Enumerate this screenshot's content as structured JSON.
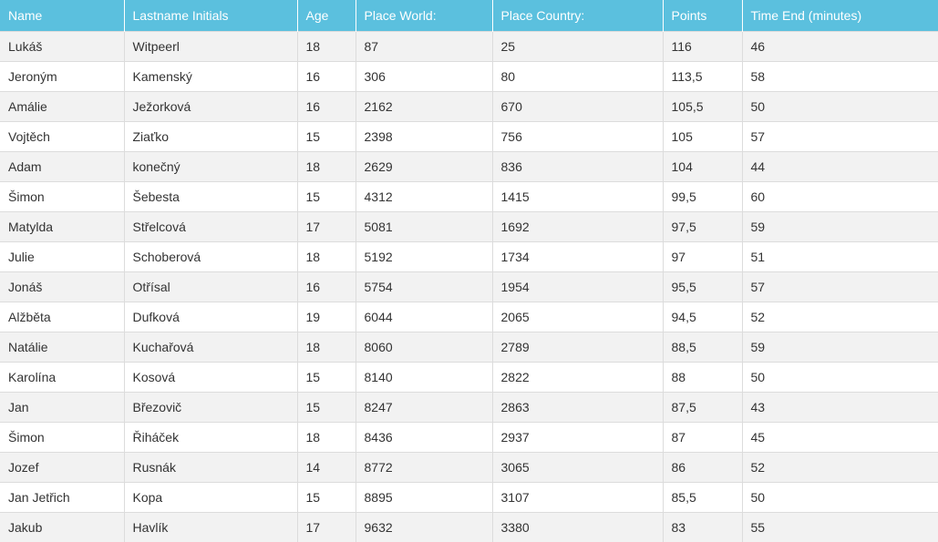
{
  "table": {
    "columns": [
      "Name",
      "Lastname Initials",
      "Age",
      "Place World:",
      "Place Country:",
      "Points",
      "Time End (minutes)"
    ],
    "rows": [
      [
        "Lukáš",
        "Witpeerl",
        "18",
        "87",
        "25",
        "116",
        "46"
      ],
      [
        "Jeroným",
        "Kamenský",
        "16",
        "306",
        "80",
        "113,5",
        "58"
      ],
      [
        "Amálie",
        "Ježorková",
        "16",
        "2162",
        "670",
        "105,5",
        "50"
      ],
      [
        "Vojtěch",
        "Ziaťko",
        "15",
        "2398",
        "756",
        "105",
        "57"
      ],
      [
        "Adam",
        "konečný",
        "18",
        "2629",
        "836",
        "104",
        "44"
      ],
      [
        "Šimon",
        "Šebesta",
        "15",
        "4312",
        "1415",
        "99,5",
        "60"
      ],
      [
        "Matylda",
        "Střelcová",
        "17",
        "5081",
        "1692",
        "97,5",
        "59"
      ],
      [
        "Julie",
        "Schoberová",
        "18",
        "5192",
        "1734",
        "97",
        "51"
      ],
      [
        "Jonáš",
        "Otřísal",
        "16",
        "5754",
        "1954",
        "95,5",
        "57"
      ],
      [
        "Alžběta",
        "Dufková",
        "19",
        "6044",
        "2065",
        "94,5",
        "52"
      ],
      [
        "Natálie",
        "Kuchařová",
        "18",
        "8060",
        "2789",
        "88,5",
        "59"
      ],
      [
        "Karolína",
        "Kosová",
        "15",
        "8140",
        "2822",
        "88",
        "50"
      ],
      [
        "Jan",
        "Březovič",
        "15",
        "8247",
        "2863",
        "87,5",
        "43"
      ],
      [
        "Šimon",
        "Řiháček",
        "18",
        "8436",
        "2937",
        "87",
        "45"
      ],
      [
        "Jozef",
        "Rusnák",
        "14",
        "8772",
        "3065",
        "86",
        "52"
      ],
      [
        "Jan Jetřich",
        "Kopa",
        "15",
        "8895",
        "3107",
        "85,5",
        "50"
      ],
      [
        "Jakub",
        "Havlík",
        "17",
        "9632",
        "3380",
        "83",
        "55"
      ]
    ]
  },
  "colors": {
    "header_background": "#5bc0de",
    "header_text": "#ffffff",
    "row_stripe": "#f2f2f2",
    "row_plain": "#ffffff",
    "cell_text": "#333333",
    "grid_line": "#dcdcdc"
  }
}
